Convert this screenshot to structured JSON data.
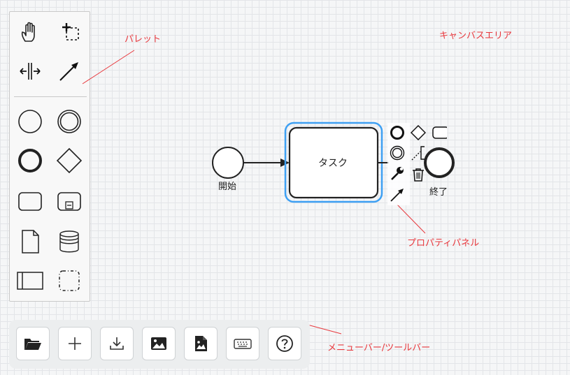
{
  "annotations": {
    "palette": "パレット",
    "canvas": "キャンバスエリア",
    "properties": "プロパティパネル",
    "toolbar": "メニューバー/ツールバー"
  },
  "diagram": {
    "start_label": "開始",
    "task_label": "タスク",
    "end_label": "終了"
  },
  "palette_tools": [
    "hand-tool",
    "lasso-tool",
    "space-tool",
    "connect-tool",
    "start-event",
    "intermediate-event",
    "end-event",
    "gateway",
    "task",
    "subprocess",
    "data-object",
    "data-store",
    "pool",
    "group"
  ],
  "toolbar_buttons": [
    "open-folder",
    "new-diagram",
    "download",
    "export-image",
    "export-svg",
    "keyboard-shortcuts",
    "help"
  ],
  "colors": {
    "selection": "#3ea0f3",
    "annotation": "#e8383d",
    "stroke": "#222222"
  }
}
